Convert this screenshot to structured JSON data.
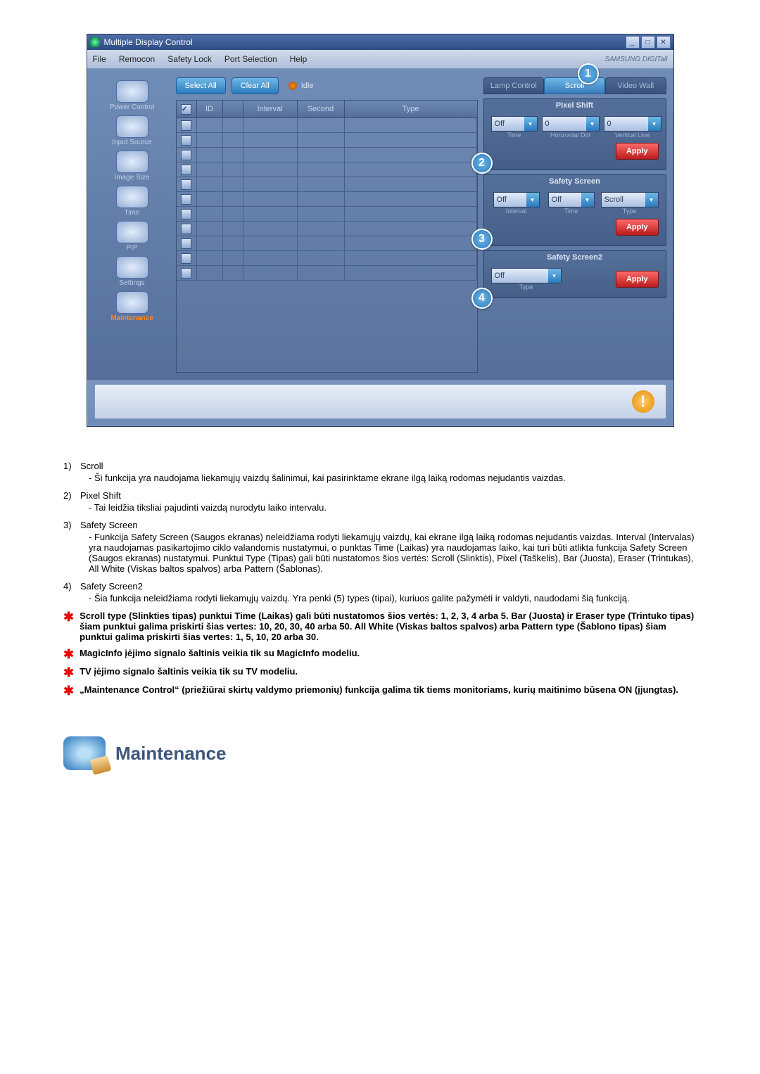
{
  "window": {
    "title": "Multiple Display Control",
    "menus": [
      "File",
      "Remocon",
      "Safety Lock",
      "Port Selection",
      "Help"
    ],
    "brand": "SAMSUNG DIGITall"
  },
  "sidebar": {
    "items": [
      {
        "label": "Power Control"
      },
      {
        "label": "Input Source"
      },
      {
        "label": "Image Size"
      },
      {
        "label": "Time"
      },
      {
        "label": "PIP"
      },
      {
        "label": "Settings"
      },
      {
        "label": "Maintenance"
      }
    ]
  },
  "toolbar": {
    "select_all": "Select All",
    "clear_all": "Clear All",
    "idle_label": "Idle"
  },
  "grid": {
    "headers": {
      "chk": "",
      "id": "ID",
      "status": "",
      "interval": "Interval",
      "second": "Second",
      "type": "Type"
    }
  },
  "right": {
    "tabs": [
      "Lamp Control",
      "Scroll",
      "Video Wall"
    ],
    "callouts": {
      "c1": "1",
      "c2": "2",
      "c3": "3",
      "c4": "4"
    },
    "pixel_shift": {
      "title": "Pixel Shift",
      "time_val": "Off",
      "hdot_val": "0",
      "vline_val": "0",
      "time_lbl": "Time",
      "hdot_lbl": "Horizontal Dot",
      "vline_lbl": "Vertical Line",
      "apply": "Apply"
    },
    "safety_screen": {
      "title": "Safety Screen",
      "interval_val": "Off",
      "time_val": "Off",
      "type_val": "Scroll",
      "interval_lbl": "Interval",
      "time_lbl": "Time",
      "type_lbl": "Type",
      "apply": "Apply"
    },
    "safety_screen2": {
      "title": "Safety Screen2",
      "type_val": "Off",
      "type_lbl": "Type",
      "apply": "Apply"
    }
  },
  "doc": {
    "items": [
      {
        "num": "1)",
        "title": "Scroll",
        "body": "- Ši funkcija yra naudojama liekamųjų vaizdų šalinimui, kai pasirinktame ekrane ilgą laiką rodomas nejudantis vaizdas."
      },
      {
        "num": "2)",
        "title": "Pixel Shift",
        "body": "- Tai leidžia tiksliai pajudinti vaizdą nurodytu laiko intervalu."
      },
      {
        "num": "3)",
        "title": "Safety Screen",
        "body": "- Funkcija Safety Screen (Saugos ekranas) neleidžiama rodyti liekamųjų vaizdų, kai ekrane ilgą laiką rodomas nejudantis vaizdas.  Interval (Intervalas) yra naudojamas pasikartojimo ciklo valandomis nustatymui, o punktas Time (Laikas) yra naudojamas laiko, kai turi būti atlikta funkcija Safety Screen (Saugos ekranas) nustatymui. Punktui Type (Tipas) gali būti nustatomos šios vertės: Scroll (Slinktis), Pixel (Taškelis), Bar (Juosta), Eraser (Trintukas), All White (Viskas baltos spalvos) arba Pattern (Šablonas)."
      },
      {
        "num": "4)",
        "title": "Safety Screen2",
        "body": "- Šia funkcija neleidžiama rodyti liekamųjų vaizdų. Yra penki (5) types (tipai), kuriuos galite pažymėti ir valdyti, naudodami šią funkciją."
      }
    ],
    "stars": [
      "Scroll type (Slinkties tipas) punktui Time (Laikas) gali būti nustatomos šios vertės: 1, 2, 3, 4 arba 5. Bar (Juosta) ir Eraser type (Trintuko tipas) šiam punktui galima priskirti šias vertes: 10, 20, 30, 40 arba 50. All White (Viskas baltos spalvos) arba Pattern type (Šablono tipas) šiam punktui galima priskirti šias vertes: 1, 5, 10, 20 arba 30.",
      "MagicInfo įėjimo signalo šaltinis veikia tik su MagicInfo modeliu.",
      "TV įėjimo signalo šaltinis veikia tik su TV modeliu.",
      "„Maintenance Control“ (priežiūrai skirtų valdymo priemonių) funkcija galima tik tiems monitoriams, kurių maitinimo būsena ON (įjungtas)."
    ],
    "section_title": "Maintenance"
  }
}
